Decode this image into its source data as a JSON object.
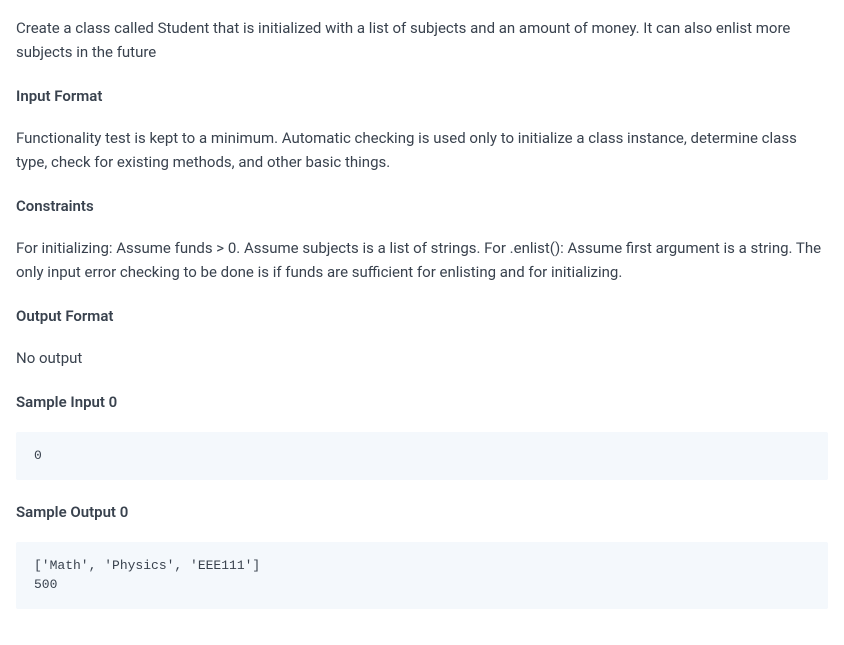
{
  "intro": "Create a class called Student that is initialized with a list of subjects and an amount of money. It can also enlist more subjects in the future",
  "sections": {
    "inputFormat": {
      "heading": "Input Format",
      "text": "Functionality test is kept to a minimum. Automatic checking is used only to initialize a class instance, determine class type, check for existing methods, and other basic things."
    },
    "constraints": {
      "heading": "Constraints",
      "text": "For initializing: Assume funds > 0. Assume subjects is a list of strings. For .enlist(): Assume first argument is a string. The only input error checking to be done is if funds are sufficient for enlisting and for initializing."
    },
    "outputFormat": {
      "heading": "Output Format",
      "text": "No output"
    },
    "sampleInput": {
      "heading": "Sample Input 0",
      "code": "0"
    },
    "sampleOutput": {
      "heading": "Sample Output 0",
      "code": "['Math', 'Physics', 'EEE111']\n500"
    }
  }
}
